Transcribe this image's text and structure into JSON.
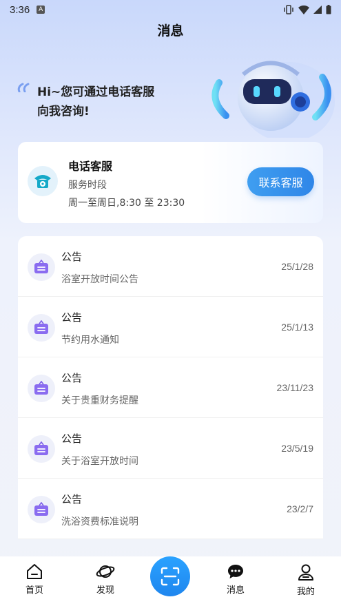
{
  "status_bar": {
    "time": "3:36",
    "badge": "A"
  },
  "page": {
    "title": "消息"
  },
  "hero": {
    "line1": "Hi~您可通过电话客服",
    "line2": "向我咨询!"
  },
  "service": {
    "title": "电话客服",
    "hours_label": "服务时段",
    "hours": "周一至周日,8:30 至 23:30",
    "contact_label": "联系客服"
  },
  "notices": [
    {
      "type": "公告",
      "title": "浴室开放时间公告",
      "date": "25/1/28"
    },
    {
      "type": "公告",
      "title": "节约用水通知",
      "date": "25/1/13"
    },
    {
      "type": "公告",
      "title": "关于贵重财务提醒",
      "date": "23/11/23"
    },
    {
      "type": "公告",
      "title": "关于浴室开放时间",
      "date": "23/5/19"
    },
    {
      "type": "公告",
      "title": "洗浴资费标准说明",
      "date": "23/2/7"
    }
  ],
  "tabs": {
    "home": "首页",
    "discover": "发现",
    "messages": "消息",
    "mine": "我的"
  },
  "icons": {
    "service": "phone-icon",
    "notice": "notice-board-icon",
    "scan": "scan-icon"
  },
  "colors": {
    "accent": "#2f86e8",
    "notice_icon": "#7c5ee8"
  }
}
